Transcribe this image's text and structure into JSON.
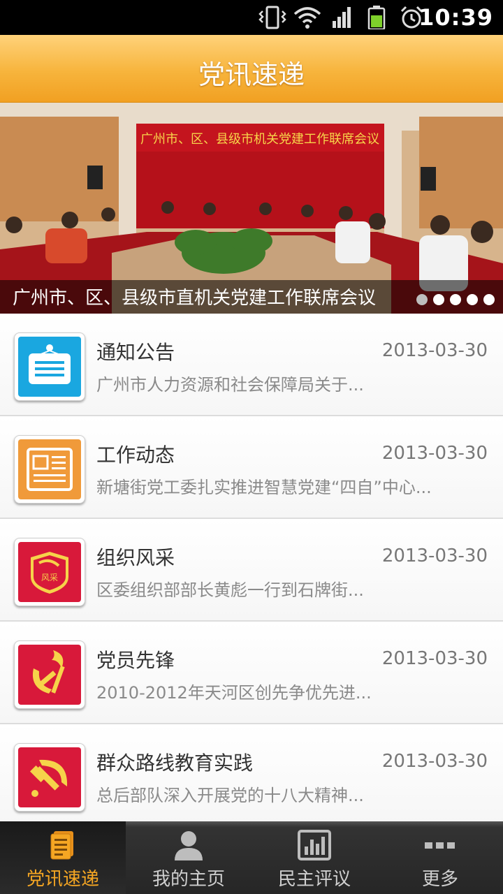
{
  "status_bar": {
    "time": "10:39",
    "icons": [
      "vibrate-icon",
      "wifi-icon",
      "signal-icon",
      "battery-icon",
      "alarm-icon"
    ]
  },
  "header": {
    "title": "党讯速递"
  },
  "banner": {
    "backdrop_text": "广州市、区、县级市机关党建工作联席会议",
    "caption": "广州市、区、县级市直机关党建工作联席会议",
    "dots_total": 5,
    "active_dot": 1
  },
  "list": {
    "items": [
      {
        "title": "通知公告",
        "date": "2013-03-30",
        "subtitle": "广州市人力资源和社会保障局关于...",
        "icon": "notice-board-icon",
        "icon_bg": "#1aa7e0"
      },
      {
        "title": "工作动态",
        "date": "2013-03-30",
        "subtitle": "新塘街党工委扎实推进智慧党建“四自”中心...",
        "icon": "newspaper-icon",
        "icon_bg": "#f09a3a"
      },
      {
        "title": "组织风采",
        "date": "2013-03-30",
        "subtitle": "区委组织部部长黄彪一行到石牌街...",
        "icon": "party-badge-icon",
        "icon_bg": "#d8193a",
        "icon_text": "风采"
      },
      {
        "title": "党员先锋",
        "date": "2013-03-30",
        "subtitle": "2010-2012年天河区创先争优先进...",
        "icon": "torch-hammer-sickle-icon",
        "icon_bg": "#d8193a"
      },
      {
        "title": "群众路线教育实践",
        "date": "2013-03-30",
        "subtitle": "总后部队深入开展党的十八大精神...",
        "icon": "hammer-sickle-icon",
        "icon_bg": "#d8193a"
      }
    ]
  },
  "tabbar": {
    "tabs": [
      {
        "label": "党讯速递",
        "icon": "news-doc-icon",
        "active": true
      },
      {
        "label": "我的主页",
        "icon": "user-icon",
        "active": false
      },
      {
        "label": "民主评议",
        "icon": "chart-icon",
        "active": false
      },
      {
        "label": "更多",
        "icon": "more-icon",
        "active": false
      }
    ]
  },
  "colors": {
    "header_gradient_top": "#ffd27a",
    "header_gradient_bottom": "#f1a022",
    "active_tab": "#f5a623",
    "party_red": "#d8193a",
    "notice_blue": "#1aa7e0",
    "news_orange": "#f09a3a"
  }
}
